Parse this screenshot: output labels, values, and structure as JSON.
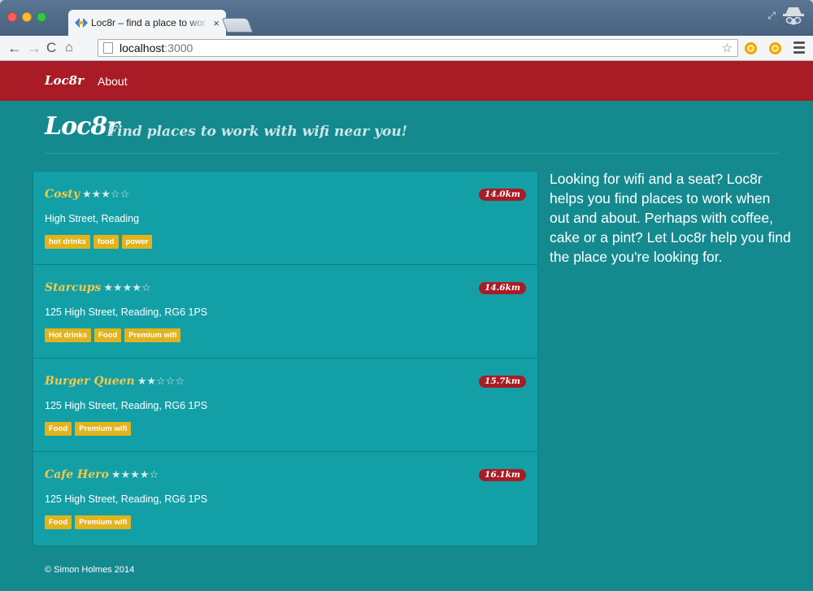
{
  "browser": {
    "tab_title": "Loc8r – find a place to wor",
    "tab_close": "×",
    "url_host": "localhost",
    "url_port": ":3000",
    "back_icon": "←",
    "forward_icon": "→",
    "reload_icon": "C",
    "home_icon": "⌂",
    "bookmark_icon": "☆",
    "restore_icon": "⤢"
  },
  "navbar": {
    "brand": "Loc8r",
    "about": "About"
  },
  "header": {
    "brand": "Loc8r",
    "tagline": "Find places to work with wifi near you!"
  },
  "locations": [
    {
      "name": "Costy",
      "stars": "★★★☆☆",
      "rating": 3,
      "distance": "14.0km",
      "address": "High Street, Reading",
      "facilities": [
        "hot drinks",
        "food",
        "power"
      ]
    },
    {
      "name": "Starcups",
      "stars": "★★★★☆",
      "rating": 4,
      "distance": "14.6km",
      "address": "125 High Street, Reading, RG6 1PS",
      "facilities": [
        "Hot drinks",
        "Food",
        "Premium wifi"
      ]
    },
    {
      "name": "Burger Queen",
      "stars": "★★☆☆☆",
      "rating": 2,
      "distance": "15.7km",
      "address": "125 High Street, Reading, RG6 1PS",
      "facilities": [
        "Food",
        "Premium wifi"
      ]
    },
    {
      "name": "Cafe Hero",
      "stars": "★★★★☆",
      "rating": 4,
      "distance": "16.1km",
      "address": "125 High Street, Reading, RG6 1PS",
      "facilities": [
        "Food",
        "Premium wifi"
      ]
    }
  ],
  "sidebar": {
    "text": "Looking for wifi and a seat? Loc8r helps you find places to work when out and about. Perhaps with coffee, cake or a pint? Let Loc8r help you find the place you're looking for."
  },
  "footer": {
    "text": "© Simon Holmes 2014"
  },
  "colors": {
    "navbar": "#a91c25",
    "background": "#148a8f",
    "list": "#139fa6",
    "accent": "#f3c94b",
    "badge": "#e2b31d"
  }
}
